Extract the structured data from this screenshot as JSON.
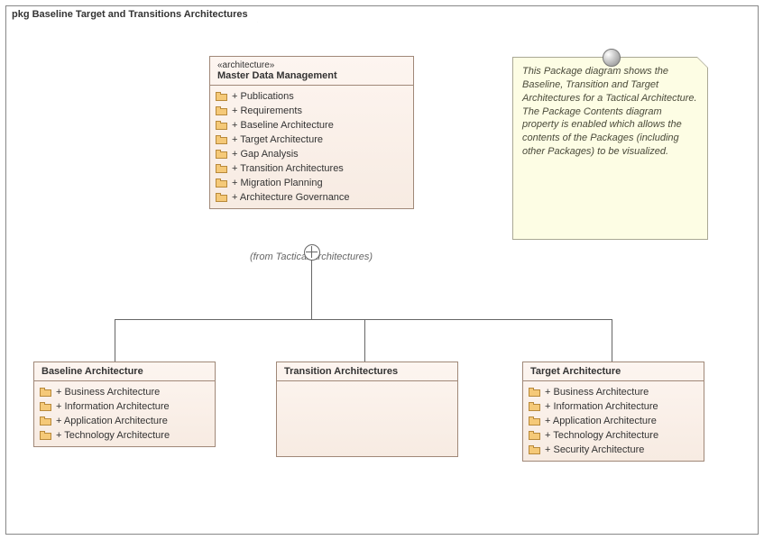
{
  "frame": {
    "title": "pkg Baseline Target and Transitions Architectures"
  },
  "master": {
    "stereo": "«architecture»",
    "title": "Master Data Management",
    "from": "(from Tactical Architectures)",
    "items": [
      "+ Publications",
      "+ Requirements",
      "+ Baseline Architecture",
      "+ Target Architecture",
      "+ Gap Analysis",
      "+ Transition Architectures",
      "+ Migration Planning",
      "+ Architecture Governance"
    ]
  },
  "note": {
    "text": "This Package diagram shows the Baseline, Transition and Target Architectures for a Tactical Architecture. The Package Contents diagram property is enabled which allows the contents of the Packages (including other Packages) to be visualized."
  },
  "baseline": {
    "title": "Baseline Architecture",
    "items": [
      "+ Business Architecture",
      "+ Information Architecture",
      "+ Application Architecture",
      "+ Technology Architecture"
    ]
  },
  "transition": {
    "title": "Transition Architectures"
  },
  "target": {
    "title": "Target Architecture",
    "items": [
      "+ Business Architecture",
      "+ Information Architecture",
      "+ Application Architecture",
      "+ Technology Architecture",
      "+ Security Architecture"
    ]
  }
}
